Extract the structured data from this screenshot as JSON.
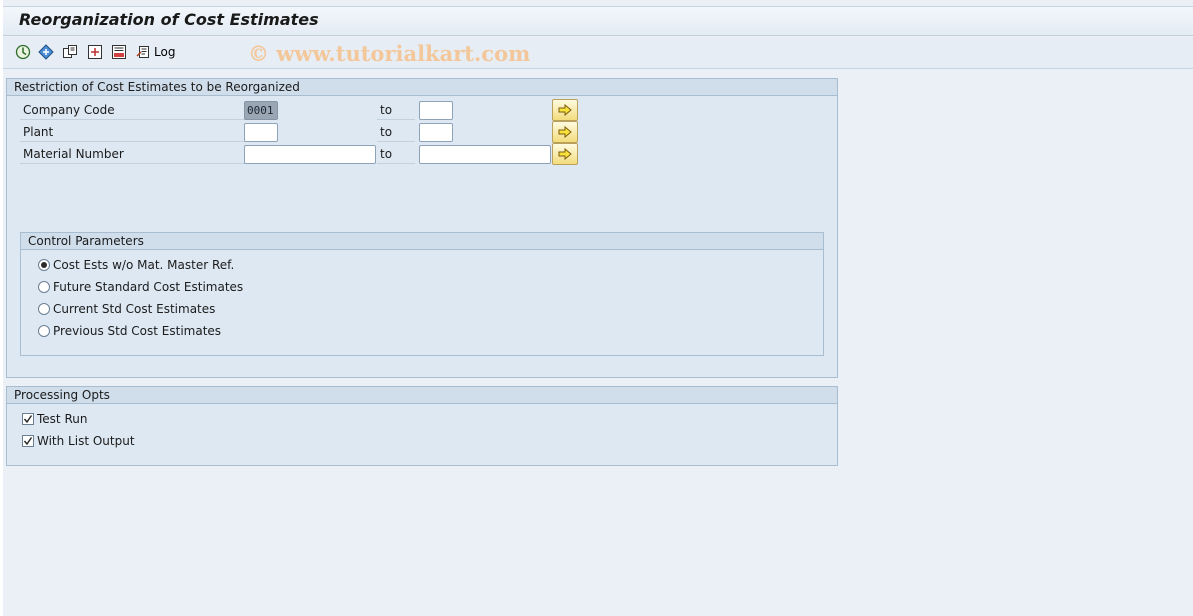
{
  "header": {
    "title": "Reorganization of Cost Estimates"
  },
  "toolbar": {
    "watermark": "© www.tutorialkart.com",
    "log_label": "Log",
    "icons": [
      "execute-icon",
      "get-variant-icon",
      "multiple-selection-icon",
      "selection-options-icon",
      "save-variant-icon",
      "log-icon"
    ]
  },
  "restriction": {
    "title": "Restriction of Cost Estimates to be Reorganized",
    "to_label": "to",
    "rows": [
      {
        "label": "Company Code",
        "from": "0001",
        "to": ""
      },
      {
        "label": "Plant",
        "from": "",
        "to": ""
      },
      {
        "label": "Material Number",
        "from": "",
        "to": ""
      }
    ]
  },
  "control": {
    "title": "Control Parameters",
    "options": [
      {
        "label": "Cost Ests w/o Mat. Master Ref.",
        "selected": true
      },
      {
        "label": "Future Standard Cost Estimates",
        "selected": false
      },
      {
        "label": "Current Std Cost Estimates",
        "selected": false
      },
      {
        "label": "Previous Std Cost Estimates",
        "selected": false
      }
    ]
  },
  "processing": {
    "title": "Processing Opts",
    "options": [
      {
        "label": "Test Run",
        "checked": true
      },
      {
        "label": "With List Output",
        "checked": true
      }
    ]
  },
  "colors": {
    "accent": "#f2dc7d",
    "panel": "#dde8f3",
    "header": "#d0ddeb"
  }
}
